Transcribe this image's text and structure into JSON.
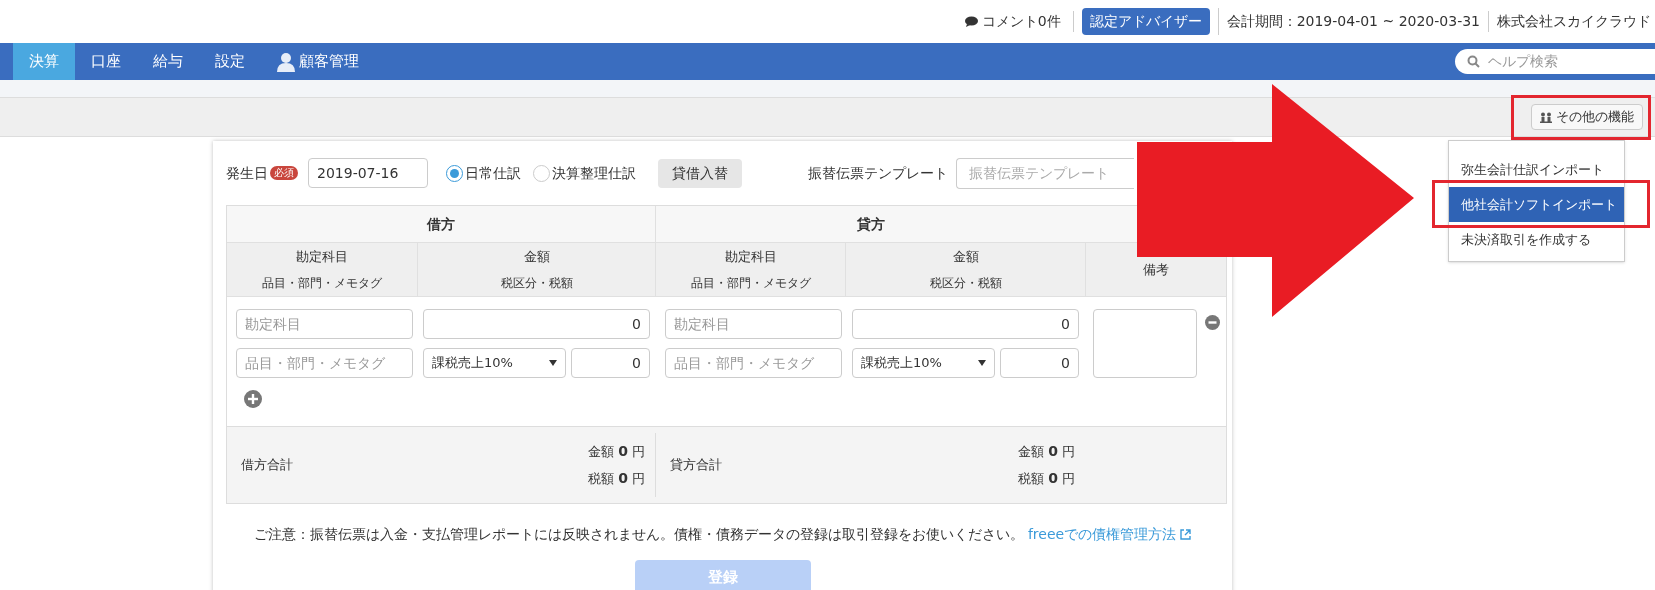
{
  "header": {
    "comment": "コメント0件",
    "advisor_badge": "認定アドバイザー",
    "period": "会計期間：2019-04-01 ~ 2020-03-31",
    "company": "株式会社スカイクラウド"
  },
  "nav": {
    "tabs": [
      {
        "label": "決算",
        "selected": true,
        "kind": "text"
      },
      {
        "label": "口座",
        "selected": false,
        "kind": "text"
      },
      {
        "label": "給与",
        "selected": false,
        "kind": "text"
      },
      {
        "label": "設定",
        "selected": false,
        "kind": "text"
      },
      {
        "label": "顧客管理",
        "selected": false,
        "kind": "user"
      }
    ],
    "help_search": {
      "placeholder": "ヘルプ検索"
    }
  },
  "toolbar": {
    "more_button": {
      "label": "その他の機能",
      "highlighted": true
    }
  },
  "menu": {
    "items": [
      {
        "label": "弥生会計仕訳インポート",
        "selected": false,
        "highlighted": false
      },
      {
        "label": "他社会計ソフトインポート",
        "selected": true,
        "highlighted": true
      },
      {
        "label": "未決済取引を作成する",
        "selected": false,
        "highlighted": false
      }
    ]
  },
  "form": {
    "date_label": "発生日",
    "required_badge": "必須",
    "date": "2019-07-16",
    "radios": [
      {
        "label": "日常仕訳",
        "selected": true
      },
      {
        "label": "決算整理仕訳",
        "selected": false
      }
    ],
    "swap_button": "貸借入替",
    "template_label": "振替伝票テンプレート",
    "template_placeholder": "振替伝票テンプレート"
  },
  "table": {
    "debit_heading": "借方",
    "credit_heading": "貸方",
    "debit_columns": [
      {
        "top": "勘定科目",
        "bottom": "品目・部門・メモタグ"
      },
      {
        "top": "金額",
        "bottom": "税区分・税額"
      }
    ],
    "credit_columns": [
      {
        "top": "勘定科目",
        "bottom": "品目・部門・メモタグ"
      },
      {
        "top": "金額",
        "bottom": "税区分・税額"
      }
    ],
    "notes_heading": "備考",
    "debit_row": {
      "account_placeholder": "勘定科目",
      "amount": "0",
      "tag_placeholder": "品目・部門・メモタグ",
      "tax": "課税売上10%",
      "tax_amount": "0"
    },
    "credit_row": {
      "account_placeholder": "勘定科目",
      "amount": "0",
      "tag_placeholder": "品目・部門・メモタグ",
      "tax": "課税売上10%",
      "tax_amount": "0"
    },
    "totals": [
      {
        "label": "借方合計",
        "amount_label": "金額",
        "amount": "0",
        "amount_unit": "円",
        "tax_label": "税額",
        "tax": "0",
        "tax_unit": "円"
      },
      {
        "label": "貸方合計",
        "amount_label": "金額",
        "amount": "0",
        "amount_unit": "円",
        "tax_label": "税額",
        "tax": "0",
        "tax_unit": "円"
      }
    ]
  },
  "notice": {
    "text": "ご注意：振替伝票は入金・支払管理レポートには反映されません。債権・債務データの登録は取引登録をお使いください。",
    "link": "freeeでの債権管理方法"
  },
  "submit": {
    "label": "登録",
    "disabled": true
  }
}
